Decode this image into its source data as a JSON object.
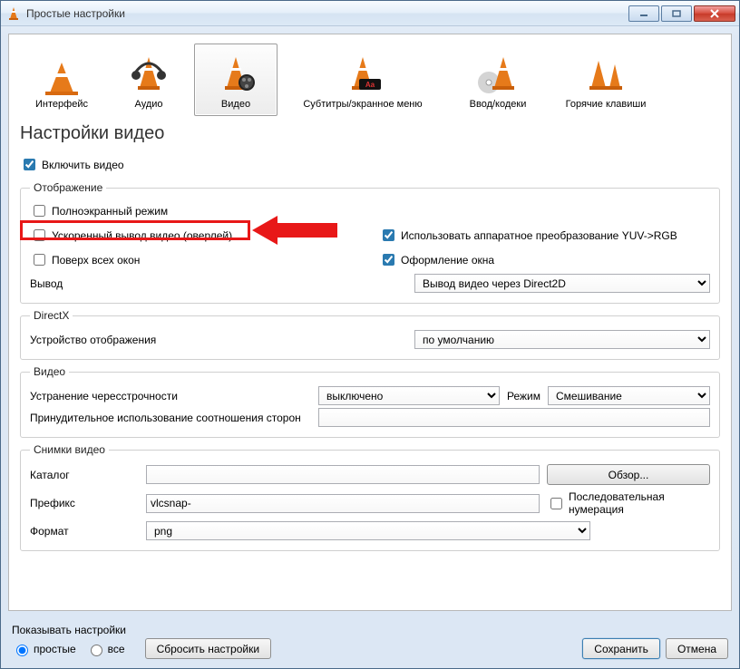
{
  "window": {
    "title": "Простые настройки"
  },
  "categories": {
    "interface": "Интерфейс",
    "audio": "Аудио",
    "video": "Видео",
    "subtitles": "Субтитры/экранное меню",
    "input": "Ввод/кодеки",
    "hotkeys": "Горячие клавиши"
  },
  "page": {
    "title": "Настройки видео"
  },
  "enable_video": "Включить видео",
  "display": {
    "legend": "Отображение",
    "fullscreen": "Полноэкранный режим",
    "overlay": "Ускоренный вывод видео (оверлей)",
    "on_top": "Поверх всех окон",
    "hw_yuv": "Использовать аппаратное преобразование YUV->RGB",
    "window_deco": "Оформление окна",
    "output_label": "Вывод",
    "output_value": "Вывод видео через Direct2D"
  },
  "directx": {
    "legend": "DirectX",
    "device_label": "Устройство отображения",
    "device_value": "по умолчанию"
  },
  "video": {
    "legend": "Видео",
    "deinterlace_label": "Устранение чересстрочности",
    "deinterlace_value": "выключено",
    "mode_label": "Режим",
    "mode_value": "Смешивание",
    "force_ar_label": "Принудительное использование соотношения сторон",
    "force_ar_value": ""
  },
  "snapshots": {
    "legend": "Снимки видео",
    "dir_label": "Каталог",
    "dir_value": "",
    "browse": "Обзор...",
    "prefix_label": "Префикс",
    "prefix_value": "vlcsnap-",
    "sequential": "Последовательная нумерация",
    "format_label": "Формат",
    "format_value": "png"
  },
  "footer": {
    "show_settings": "Показывать настройки",
    "simple": "простые",
    "all": "все",
    "reset": "Сбросить настройки",
    "save": "Сохранить",
    "cancel": "Отмена"
  }
}
